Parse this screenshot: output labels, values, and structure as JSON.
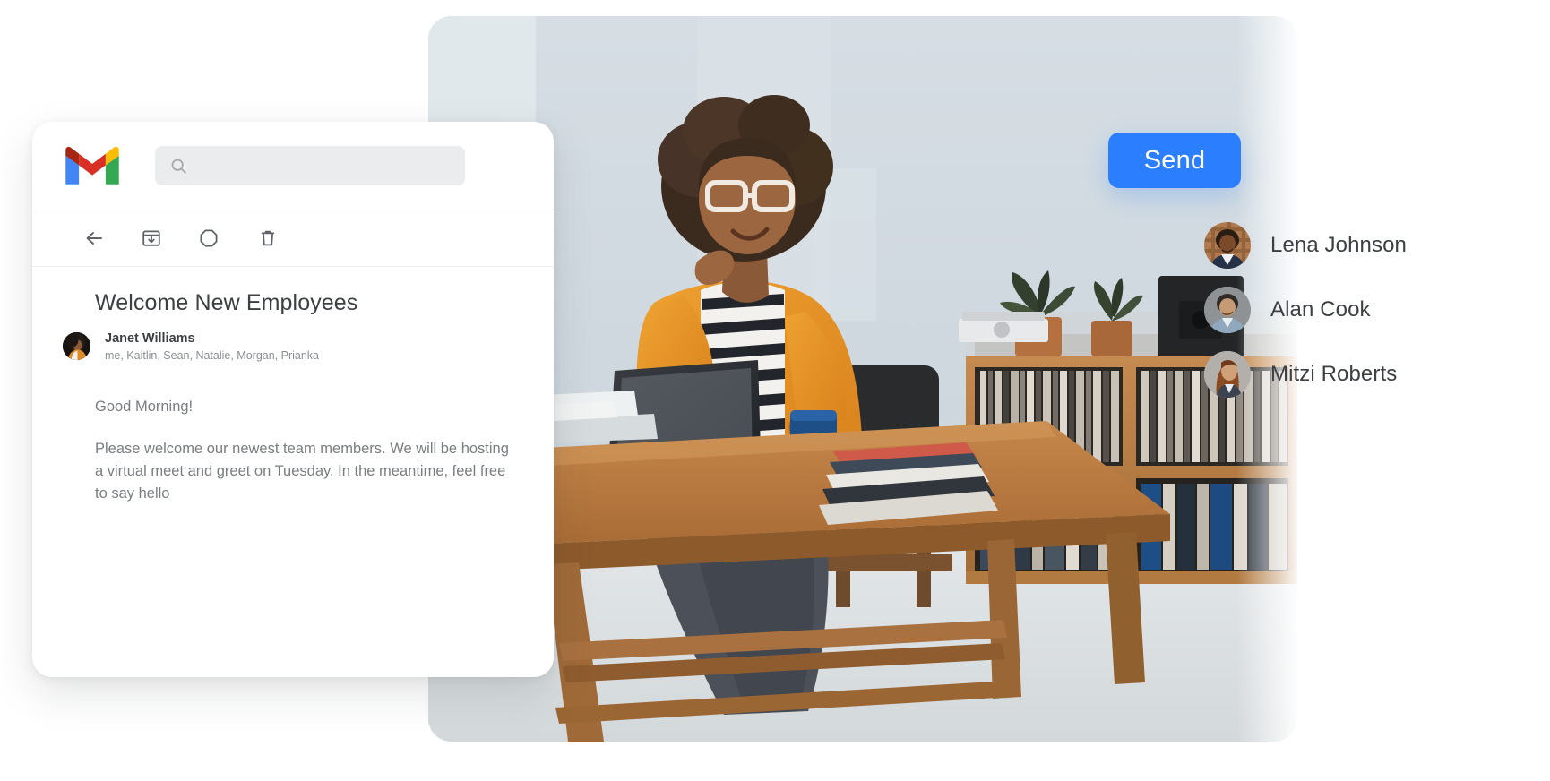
{
  "app": {
    "name": "Gmail",
    "logo_icon": "gmail-logo-icon",
    "logo_colors": {
      "blue": "#4285F4",
      "red": "#D93025",
      "dark_red": "#A52714",
      "yellow": "#FBBC04",
      "green": "#34A853"
    }
  },
  "search": {
    "icon": "search-icon",
    "value": "",
    "placeholder": ""
  },
  "toolbar": {
    "items": [
      {
        "name": "back-icon",
        "label": "Back"
      },
      {
        "name": "archive-icon",
        "label": "Archive"
      },
      {
        "name": "spam-icon",
        "label": "Report spam"
      },
      {
        "name": "trash-icon",
        "label": "Delete"
      }
    ]
  },
  "email": {
    "subject": "Welcome New Employees",
    "sender": "Janet Williams",
    "recipients": "me, Kaitlin, Sean, Natalie, Morgan, Prianka",
    "avatar_icon": "sender-avatar",
    "body": [
      "Good Morning!",
      "Please welcome our newest team members. We will be hosting a virtual meet and greet on Tuesday. In the meantime, feel free to say hello"
    ]
  },
  "send": {
    "label": "Send",
    "color": "#2b7fff"
  },
  "contacts": {
    "items": [
      {
        "name": "Lena Johnson",
        "avatar_icon": "avatar-lena-johnson"
      },
      {
        "name": "Alan Cook",
        "avatar_icon": "avatar-alan-cook"
      },
      {
        "name": "Mitzi Roberts",
        "avatar_icon": "avatar-mitzi-roberts"
      }
    ]
  },
  "hero": {
    "alt": "Woman in orange cardigan sitting at a wooden table working on a tablet in an office with shelves, plants, records and a speaker",
    "icon": "hero-photo"
  }
}
